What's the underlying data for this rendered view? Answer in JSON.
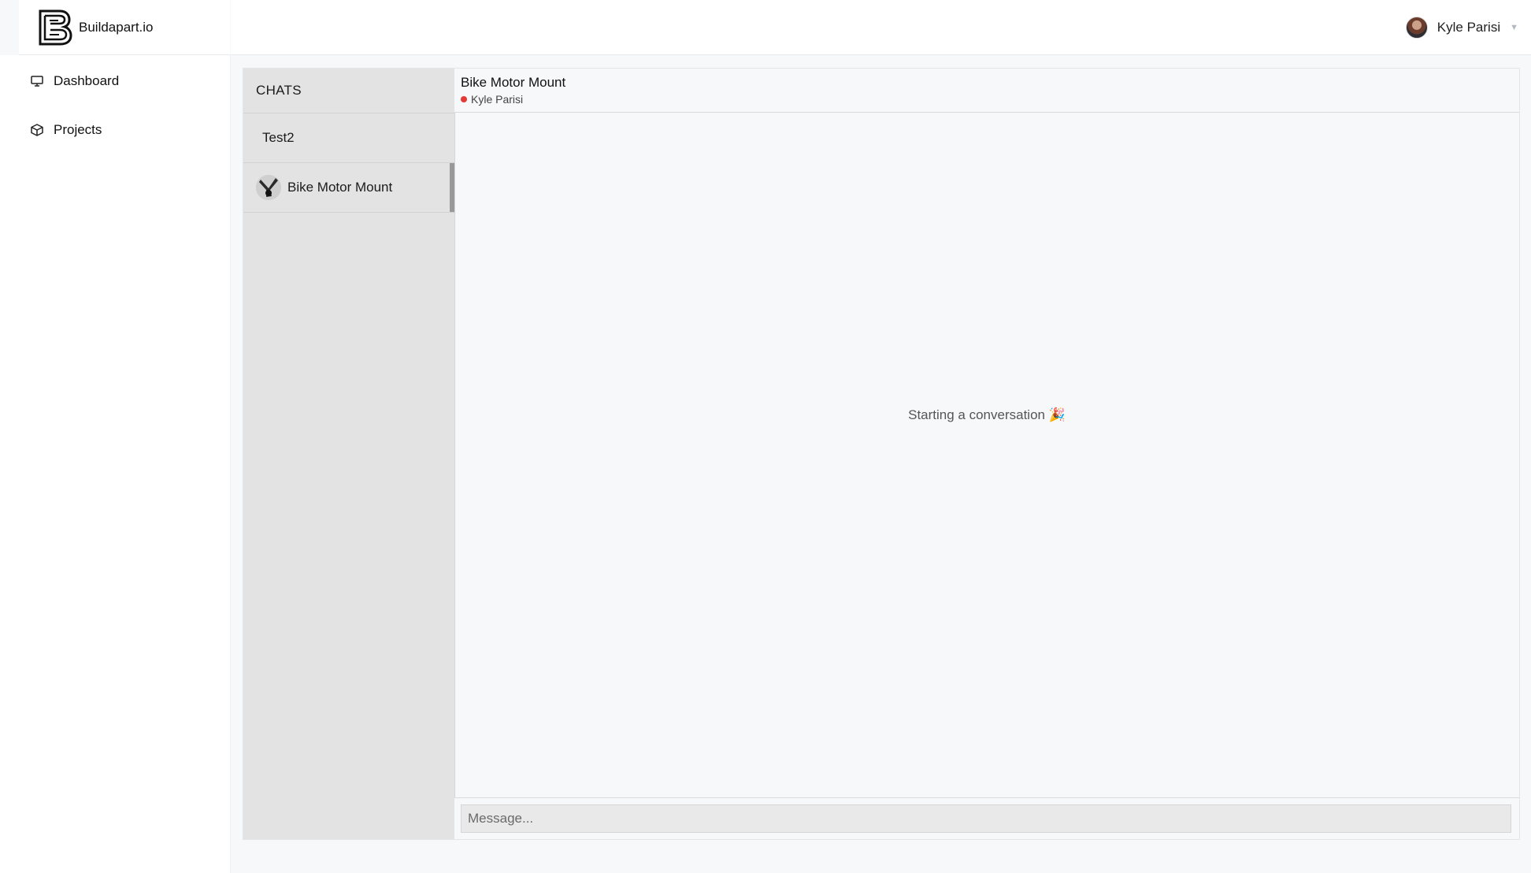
{
  "brand": {
    "name": "Buildapart.io"
  },
  "sidebar": {
    "items": [
      {
        "label": "Dashboard",
        "icon": "monitor-icon"
      },
      {
        "label": "Projects",
        "icon": "cube-icon"
      }
    ]
  },
  "header": {
    "user_name": "Kyle Parisi"
  },
  "chats": {
    "title": "CHATS",
    "items": [
      {
        "label": "Test2",
        "active": false
      },
      {
        "label": "Bike Motor Mount",
        "active": true
      }
    ]
  },
  "conversation": {
    "title": "Bike Motor Mount",
    "participant": "Kyle Parisi",
    "participant_status_color": "#e53935",
    "empty_message": "Starting a conversation 🎉",
    "input_placeholder": "Message..."
  },
  "colors": {
    "chat_list_bg": "#e3e3e3",
    "page_bg": "#f7f8fa",
    "active_indicator": "#999999"
  }
}
